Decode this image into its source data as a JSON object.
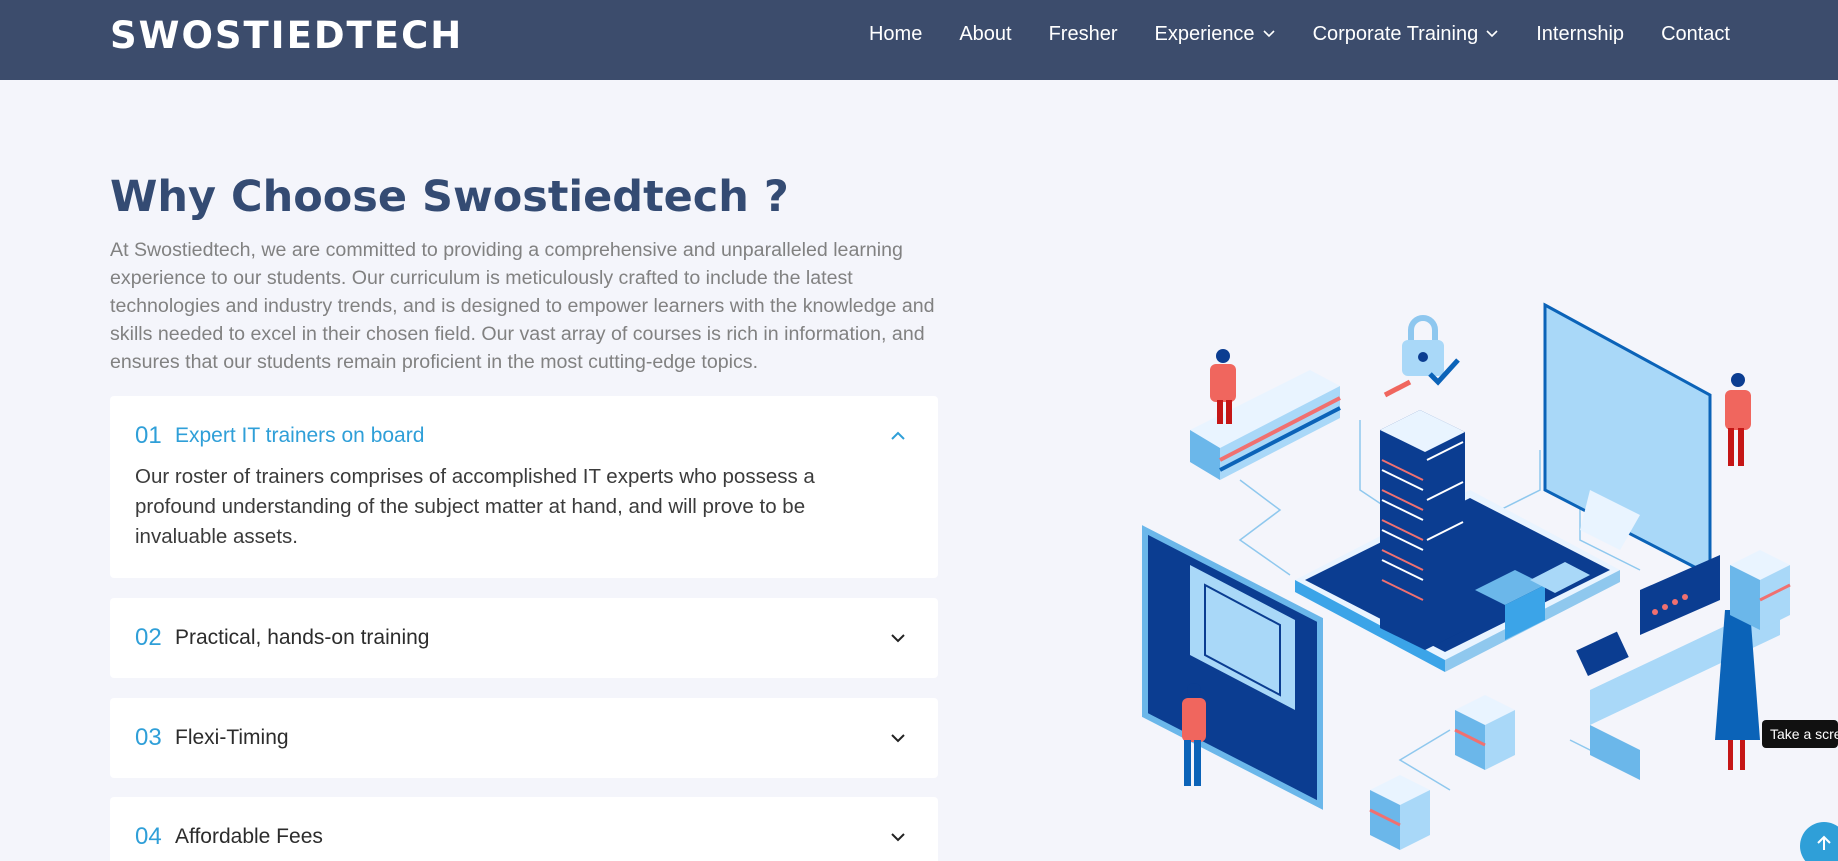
{
  "header": {
    "brand": "SWOSTIEDTECH",
    "nav": [
      {
        "label": "Home",
        "dropdown": false
      },
      {
        "label": "About",
        "dropdown": false
      },
      {
        "label": "Fresher",
        "dropdown": false
      },
      {
        "label": "Experience",
        "dropdown": true
      },
      {
        "label": "Corporate Training",
        "dropdown": true
      },
      {
        "label": "Internship",
        "dropdown": false
      },
      {
        "label": "Contact",
        "dropdown": false
      }
    ]
  },
  "section": {
    "title": "Why Choose Swostiedtech ?",
    "intro": "At Swostiedtech, we are committed to providing a comprehensive and unparalleled learning experience to our students. Our curriculum is meticulously crafted to include the latest technologies and industry trends, and is designed to empower learners with the knowledge and skills needed to excel in their chosen field. Our vast array of courses is rich in information, and ensures that our students remain proficient in the most cutting-edge topics.",
    "accordion": [
      {
        "num": "01",
        "title": "Expert IT trainers on board",
        "open": true,
        "body": "Our roster of trainers comprises of accomplished IT experts who possess a profound understanding of the subject matter at hand, and will prove to be invaluable assets."
      },
      {
        "num": "02",
        "title": "Practical, hands-on training",
        "open": false
      },
      {
        "num": "03",
        "title": "Flexi-Timing",
        "open": false
      },
      {
        "num": "04",
        "title": "Affordable Fees",
        "open": false
      }
    ]
  },
  "overlay": {
    "screenshot_tip": "Take a scre"
  },
  "colors": {
    "nav_bg": "#3c4c6c",
    "page_bg": "#f4f5fb",
    "heading": "#344b73",
    "accent": "#2f9fd8"
  },
  "icons": [
    "chevron-down-icon",
    "chevron-up-icon",
    "arrow-up-icon"
  ]
}
